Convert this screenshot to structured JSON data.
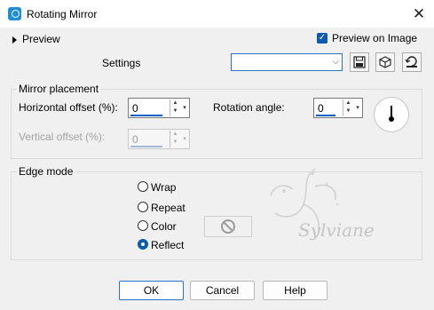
{
  "window": {
    "title": "Rotating Mirror",
    "close_glyph": "✕"
  },
  "preview": {
    "toggle_label": "Preview",
    "checkbox_label": "Preview on Image",
    "checked": true
  },
  "settings": {
    "label": "Settings",
    "combo_value": ""
  },
  "mirror_placement": {
    "title": "Mirror placement",
    "horizontal_offset": {
      "label": "Horizontal offset (%):",
      "value": "0"
    },
    "vertical_offset": {
      "label": "Vertical offset (%):",
      "value": "0"
    },
    "rotation_angle": {
      "label": "Rotation angle:",
      "value": "0"
    }
  },
  "edge_mode": {
    "title": "Edge mode",
    "options": [
      {
        "label": "Wrap",
        "selected": false
      },
      {
        "label": "Repeat",
        "selected": false
      },
      {
        "label": "Color",
        "selected": false
      },
      {
        "label": "Reflect",
        "selected": true
      }
    ]
  },
  "watermark": {
    "text": "Sylviane"
  },
  "buttons": {
    "ok": "OK",
    "cancel": "Cancel",
    "help": "Help"
  },
  "icons": {
    "save": "save-icon",
    "delete": "delete-preset-icon",
    "reset": "reset-icon",
    "no_color": "no-symbol-icon"
  }
}
